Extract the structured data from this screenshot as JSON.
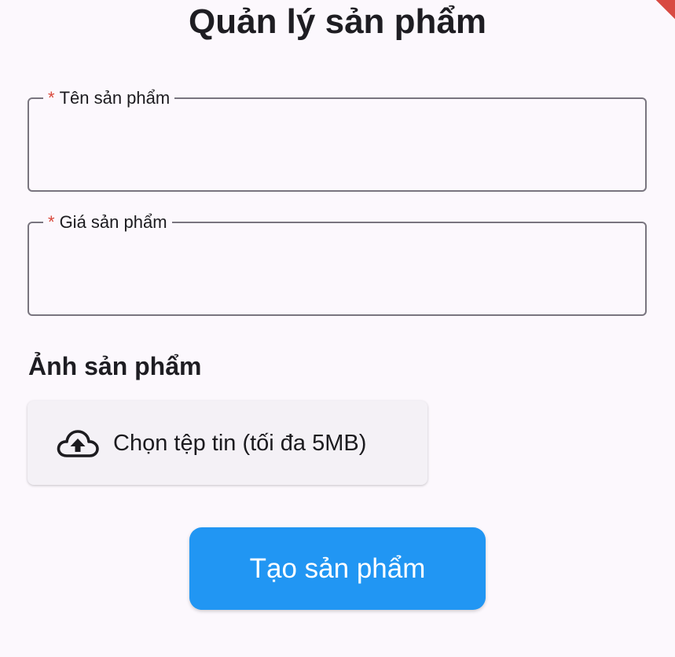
{
  "page": {
    "title": "Quản lý sản phẩm"
  },
  "form": {
    "name_field": {
      "required_mark": "*",
      "label": "Tên sản phẩm",
      "value": ""
    },
    "price_field": {
      "required_mark": "*",
      "label": "Giá sản phẩm",
      "value": ""
    },
    "image_section": {
      "heading": "Ảnh sản phẩm",
      "upload_label": "Chọn tệp tin (tối đa 5MB)",
      "upload_icon": "cloud-upload-icon"
    },
    "submit_label": "Tạo sản phẩm"
  },
  "colors": {
    "background": "#fcf8fd",
    "primary": "#2196f3",
    "required": "#d9483b",
    "outline": "#79757f",
    "debug_banner": "#d84a42"
  }
}
